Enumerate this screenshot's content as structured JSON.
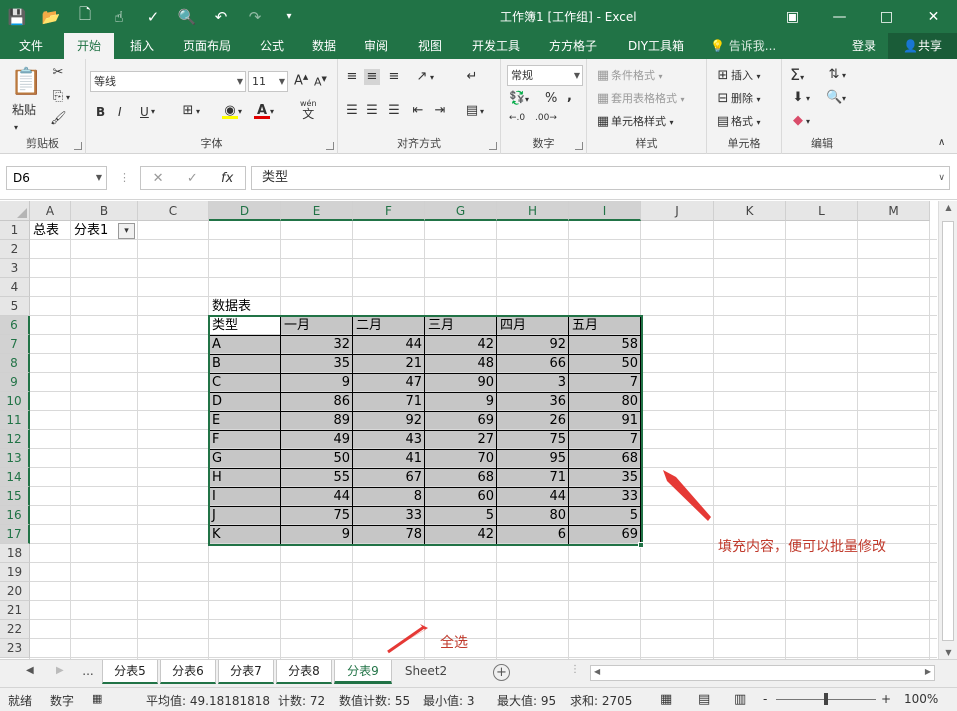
{
  "window": {
    "title": "工作簿1  [工作组] - Excel"
  },
  "ribbon_tabs": [
    "文件",
    "开始",
    "插入",
    "页面布局",
    "公式",
    "数据",
    "审阅",
    "视图",
    "开发工具",
    "方方格子",
    "DIY工具箱"
  ],
  "tellme": "告诉我...",
  "login": "登录",
  "share": "共享",
  "clipboard": {
    "paste": "粘贴",
    "label": "剪贴板"
  },
  "font": {
    "name": "等线",
    "size": "11",
    "bold": "B",
    "italic": "I",
    "underline": "U",
    "grow": "A",
    "shrink": "A",
    "label": "字体",
    "wen": "wén",
    "wen_char": "文"
  },
  "alignment": {
    "label": "对齐方式"
  },
  "number": {
    "format": "常规",
    "percent": "%",
    "comma": ",",
    "label": "数字"
  },
  "styles": {
    "cond": "条件格式",
    "table": "套用表格格式",
    "cell": "单元格样式",
    "label": "样式"
  },
  "cells": {
    "insert": "插入",
    "delete": "删除",
    "format": "格式",
    "label": "单元格"
  },
  "editing": {
    "label": "编辑"
  },
  "formula_bar": {
    "name_box": "D6",
    "content": "类型",
    "fx": "fx"
  },
  "columns": [
    "A",
    "B",
    "C",
    "D",
    "E",
    "F",
    "G",
    "H",
    "I",
    "J",
    "K",
    "L",
    "M"
  ],
  "rows": [
    "1",
    "2",
    "3",
    "4",
    "5",
    "6",
    "7",
    "8",
    "9",
    "10",
    "11",
    "12",
    "13",
    "14",
    "15",
    "16",
    "17",
    "18",
    "19",
    "20",
    "21",
    "22",
    "23"
  ],
  "cells_a1": {
    "a1": "总表",
    "b1": "分表1",
    "d5": "数据表"
  },
  "table": {
    "headers": [
      "类型",
      "一月",
      "二月",
      "三月",
      "四月",
      "五月"
    ],
    "rows": [
      [
        "A",
        "32",
        "44",
        "42",
        "92",
        "58"
      ],
      [
        "B",
        "35",
        "21",
        "48",
        "66",
        "50"
      ],
      [
        "C",
        "9",
        "47",
        "90",
        "3",
        "7"
      ],
      [
        "D",
        "86",
        "71",
        "9",
        "36",
        "80"
      ],
      [
        "E",
        "89",
        "92",
        "69",
        "26",
        "91"
      ],
      [
        "F",
        "49",
        "43",
        "27",
        "75",
        "7"
      ],
      [
        "G",
        "50",
        "41",
        "70",
        "95",
        "68"
      ],
      [
        "H",
        "55",
        "67",
        "68",
        "71",
        "35"
      ],
      [
        "I",
        "44",
        "8",
        "60",
        "44",
        "33"
      ],
      [
        "J",
        "75",
        "33",
        "5",
        "80",
        "5"
      ],
      [
        "K",
        "9",
        "78",
        "42",
        "6",
        "69"
      ]
    ]
  },
  "annotations": {
    "fill": "填充内容，便可以批量修改",
    "select_all": "全选"
  },
  "sheets": {
    "ellipsis": "...",
    "tabs": [
      "分表5",
      "分表6",
      "分表7",
      "分表8",
      "分表9",
      "Sheet2"
    ]
  },
  "status": {
    "ready": "就绪",
    "numlock": "数字",
    "average": "平均值: 49.18181818",
    "count": "计数: 72",
    "numcount": "数值计数: 55",
    "min": "最小值: 3",
    "max": "最大值: 95",
    "sum": "求和: 2705",
    "zoom": "100%",
    "minus": "-",
    "plus": "+"
  },
  "colors": {
    "accent": "#217346",
    "annotation": "#c0392b"
  }
}
